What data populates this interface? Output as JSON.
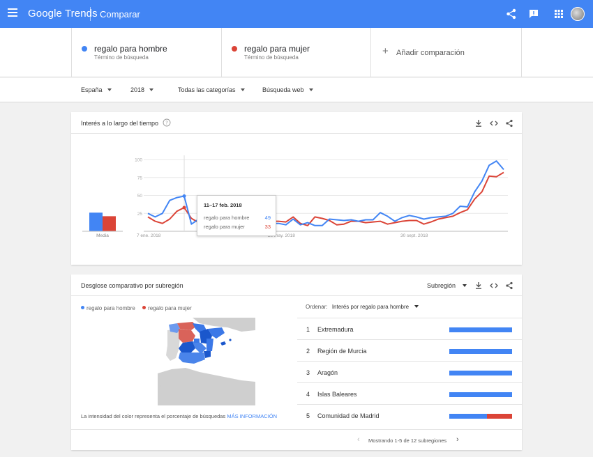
{
  "appbar": {
    "logo": "Google Trends",
    "title": "Comparar",
    "bg_color": "#4285f4"
  },
  "terms": [
    {
      "name": "regalo para hombre",
      "sub": "Término de búsqueda",
      "color": "#4285f4"
    },
    {
      "name": "regalo para mujer",
      "sub": "Término de búsqueda",
      "color": "#db4437"
    }
  ],
  "add_comparison": "Añadir comparación",
  "filters": [
    "España",
    "2018",
    "Todas las categorías",
    "Búsqueda web"
  ],
  "interest_card": {
    "title": "Interés a lo largo del tiempo",
    "average_label": "Media",
    "tooltip": {
      "title": "11–17 feb. 2018",
      "rows": [
        {
          "label": "regalo para hombre",
          "value": "49"
        },
        {
          "label": "regalo para mujer",
          "value": "33"
        }
      ]
    }
  },
  "chart_data": {
    "type": "line",
    "ylim": [
      0,
      100
    ],
    "yticks": [
      "100",
      "75",
      "50",
      "25"
    ],
    "x_labels": [
      "7 ene. 2018",
      "20 may. 2018",
      "30 sept. 2018"
    ],
    "averages": [
      26,
      21
    ],
    "series": [
      {
        "name": "regalo para hombre",
        "color": "#4285f4",
        "values": [
          25,
          20,
          25,
          43,
          47,
          49,
          10,
          17,
          22,
          24,
          21,
          12,
          15,
          16,
          12,
          18,
          14,
          11,
          11,
          9,
          17,
          9,
          12,
          8,
          8,
          17,
          16,
          15,
          16,
          14,
          16,
          16,
          26,
          21,
          14,
          19,
          22,
          20,
          17,
          19,
          20,
          21,
          25,
          35,
          34,
          55,
          70,
          92,
          98,
          86
        ]
      },
      {
        "name": "regalo para mujer",
        "color": "#db4437",
        "values": [
          20,
          14,
          11,
          17,
          28,
          33,
          18,
          12,
          14,
          16,
          19,
          14,
          17,
          20,
          18,
          14,
          25,
          14,
          14,
          13,
          20,
          11,
          8,
          20,
          18,
          15,
          9,
          10,
          14,
          14,
          12,
          13,
          14,
          10,
          12,
          14,
          15,
          15,
          10,
          13,
          17,
          19,
          21,
          26,
          30,
          45,
          55,
          77,
          76,
          82
        ]
      }
    ]
  },
  "subregion_card": {
    "title": "Desglose comparativo por subregión",
    "view_select": "Subregión",
    "order_label": "Ordenar:",
    "order_value": "Interés por regalo para hombre",
    "legend": [
      "regalo para hombre",
      "regalo para mujer"
    ],
    "rankings": [
      {
        "rank": "1",
        "name": "Extremadura",
        "hombre": 100,
        "mujer": 0
      },
      {
        "rank": "2",
        "name": "Región de Murcia",
        "hombre": 100,
        "mujer": 0
      },
      {
        "rank": "3",
        "name": "Aragón",
        "hombre": 100,
        "mujer": 0
      },
      {
        "rank": "4",
        "name": "Islas Baleares",
        "hombre": 100,
        "mujer": 0
      },
      {
        "rank": "5",
        "name": "Comunidad de Madrid",
        "hombre": 60,
        "mujer": 40
      }
    ],
    "map_note": "La intensidad del color representa el porcentaje de búsquedas",
    "map_note_link": "MÁS INFORMACIÓN",
    "pagination": "Mostrando 1-5 de 12 subregiones"
  }
}
